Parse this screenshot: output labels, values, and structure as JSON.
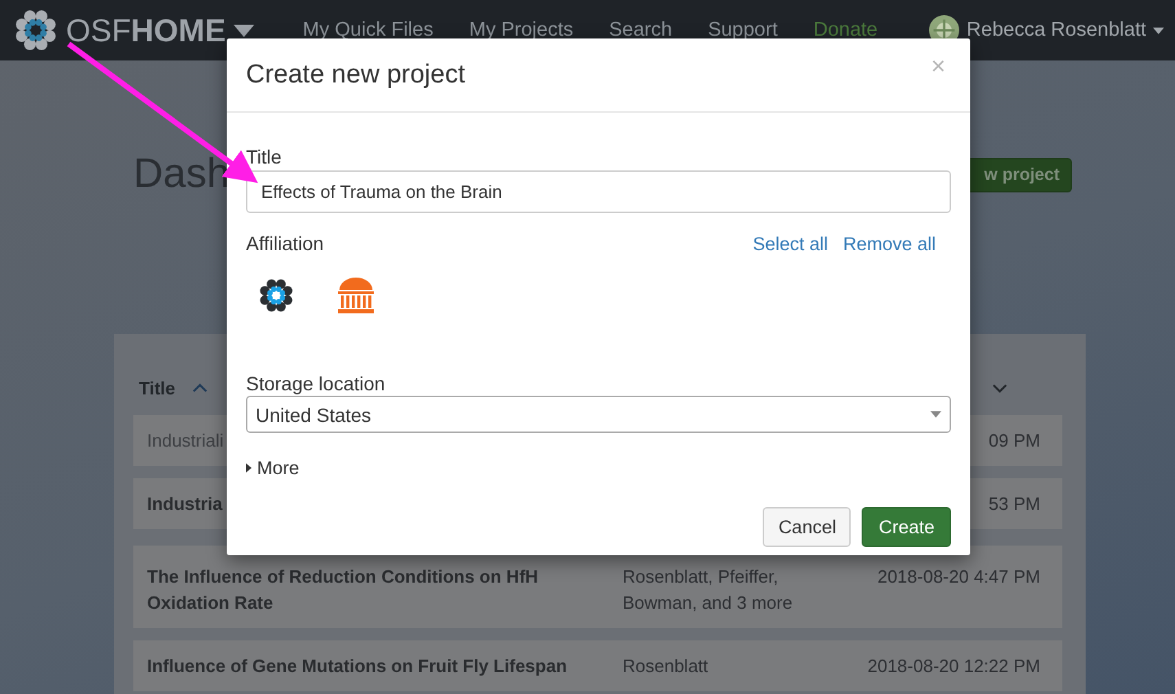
{
  "navbar": {
    "brand_light": "OSF",
    "brand_bold": "HOME",
    "links": [
      {
        "label": "My Quick Files",
        "kind": "plain"
      },
      {
        "label": "My Projects",
        "kind": "plain"
      },
      {
        "label": "Search",
        "kind": "plain"
      },
      {
        "label": "Support",
        "kind": "plain"
      },
      {
        "label": "Donate",
        "kind": "donate"
      }
    ],
    "user": "Rebecca Rosenblatt"
  },
  "page": {
    "heading": "Dash",
    "create_button": "w project"
  },
  "table": {
    "columns": [
      {
        "label": "Title"
      }
    ],
    "rows": [
      {
        "title": [
          "Industriali"
        ],
        "contributors": [],
        "modified": [
          "09 PM"
        ],
        "bold": false
      },
      {
        "title": [
          "Industria"
        ],
        "contributors": [],
        "modified": [
          "53 PM"
        ],
        "bold": true
      },
      {
        "title": [
          "The Influence of Reduction Conditions on HfH",
          "Oxidation Rate"
        ],
        "contributors": [
          "Rosenblatt, Pfeiffer,",
          "Bowman, and 3 more"
        ],
        "modified": [
          "2018-08-20 4:47 PM"
        ],
        "bold": true
      },
      {
        "title": [
          "Influence of Gene Mutations on Fruit Fly Lifespan"
        ],
        "contributors": [
          "Rosenblatt"
        ],
        "modified": [
          "2018-08-20 12:22 PM"
        ],
        "bold": true
      }
    ]
  },
  "modal": {
    "title": "Create new project",
    "close": "×",
    "title_label": "Title",
    "title_value": "Effects of Trauma on the Brain",
    "affiliation_label": "Affiliation",
    "affiliation_actions": [
      "Select all",
      "Remove all"
    ],
    "storage_label": "Storage location",
    "storage_value": "United States",
    "more": {
      "label": "More",
      "expanded": false
    },
    "buttons": [
      {
        "label": "Cancel",
        "kind": "default"
      },
      {
        "label": "Create",
        "kind": "primary"
      }
    ]
  }
}
